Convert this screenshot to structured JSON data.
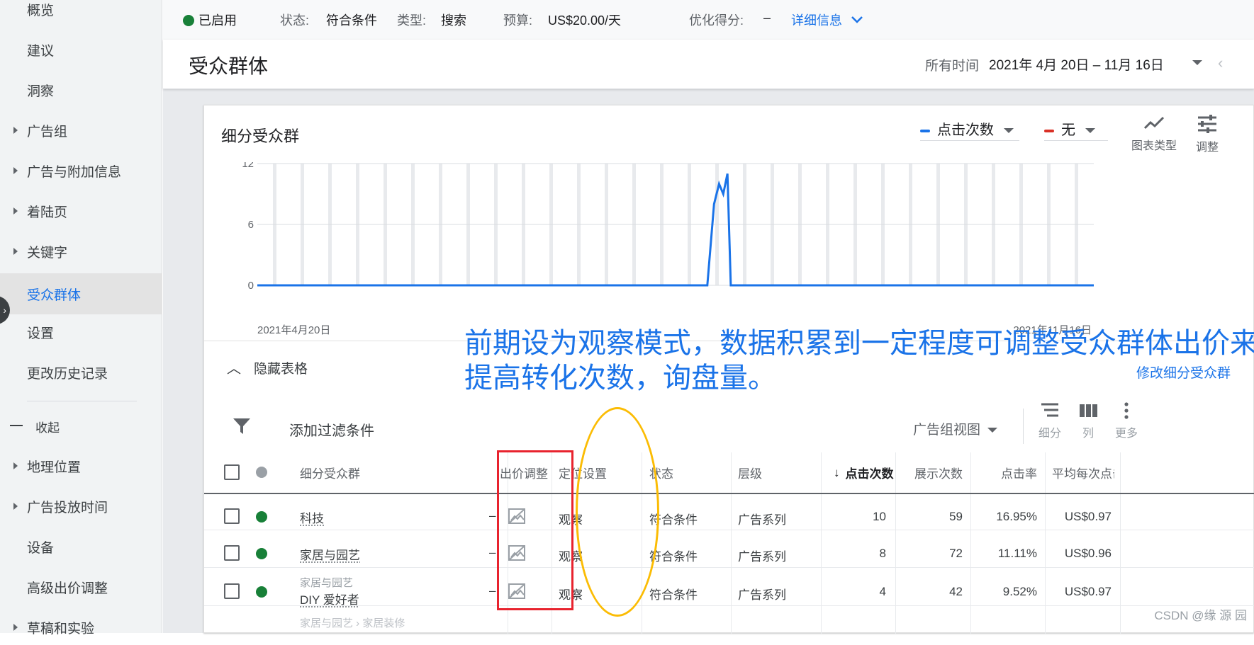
{
  "sidebar": {
    "items": [
      {
        "label": "概览",
        "caret": false
      },
      {
        "label": "建议",
        "caret": false
      },
      {
        "label": "洞察",
        "caret": false
      },
      {
        "label": "广告组",
        "caret": true
      },
      {
        "label": "广告与附加信息",
        "caret": true
      },
      {
        "label": "着陆页",
        "caret": true
      },
      {
        "label": "关键字",
        "caret": true
      },
      {
        "label": "受众群体",
        "caret": false,
        "active": true
      },
      {
        "label": "设置",
        "caret": false
      },
      {
        "label": "更改历史记录",
        "caret": false
      }
    ],
    "collapse_label": "收起",
    "more_items": [
      {
        "label": "地理位置",
        "caret": true
      },
      {
        "label": "广告投放时间",
        "caret": true
      },
      {
        "label": "设备",
        "caret": false
      },
      {
        "label": "高级出价调整",
        "caret": false
      },
      {
        "label": "草稿和实验",
        "caret": true
      }
    ]
  },
  "status_bar": {
    "enabled": "已启用",
    "status_label": "状态:",
    "status_value": "符合条件",
    "type_label": "类型:",
    "type_value": "搜索",
    "budget_label": "预算:",
    "budget_value": "US$20.00/天",
    "score_label": "优化得分:",
    "score_value": "–",
    "details_link": "详细信息"
  },
  "header": {
    "title": "受众群体",
    "date_label": "所有时间",
    "date_range": "2021年 4月 20日 – 11月 16日"
  },
  "chart_section": {
    "title": "细分受众群",
    "metric1": "点击次数",
    "metric1_color": "#1a73e8",
    "metric2": "无",
    "metric2_color": "#d93025",
    "chart_type_label": "图表类型",
    "adjust_label": "调整"
  },
  "chart_data": {
    "type": "line",
    "series": [
      {
        "name": "点击次数",
        "color": "#1a73e8",
        "points": [
          [
            0,
            0
          ],
          [
            0.538,
            0
          ],
          [
            0.546,
            8
          ],
          [
            0.552,
            10
          ],
          [
            0.557,
            9
          ],
          [
            0.562,
            11
          ],
          [
            0.566,
            0
          ],
          [
            1,
            0
          ]
        ]
      }
    ],
    "yticks": [
      0,
      6,
      12
    ],
    "ylim": [
      0,
      12
    ],
    "x_start_label": "2021年4月20日",
    "x_end_label": "2021年11月16日",
    "grid": true
  },
  "annotation": {
    "line1": "前期设为观察模式，数据积累到一定程度可调整受众群体出价来",
    "line2": "提高转化次数，询盘量。"
  },
  "table_controls": {
    "hide_table": "隐藏表格",
    "modify_segments": "修改细分受众群",
    "add_filter": "添加过滤条件",
    "adgroup_view": "广告组视图",
    "segment": "细分",
    "columns": "列",
    "more": "更多"
  },
  "table": {
    "headers": {
      "segment": "细分受众群",
      "bid_adj": "出价调整",
      "targeting": "定位设置",
      "status": "状态",
      "level": "层级",
      "clicks": "点击次数",
      "impressions": "展示次数",
      "ctr": "点击率",
      "avg_cpc": "平均每次点击"
    },
    "rows": [
      {
        "parent": "",
        "segment": "科技",
        "bid_adj": "–",
        "targeting": "观察",
        "status": "符合条件",
        "level": "广告系列",
        "clicks": "10",
        "impressions": "59",
        "ctr": "16.95%",
        "avg_cpc": "US$0.97"
      },
      {
        "parent": "",
        "segment": "家居与园艺",
        "bid_adj": "–",
        "targeting": "观察",
        "status": "符合条件",
        "level": "广告系列",
        "clicks": "8",
        "impressions": "72",
        "ctr": "11.11%",
        "avg_cpc": "US$0.96"
      },
      {
        "parent": "家居与园艺",
        "segment": "DIY 爱好者",
        "bid_adj": "–",
        "targeting": "观察",
        "status": "符合条件",
        "level": "广告系列",
        "clicks": "4",
        "impressions": "42",
        "ctr": "9.52%",
        "avg_cpc": "US$0.97"
      }
    ],
    "partial_row": "家居与园艺 › 家居装修"
  },
  "watermark": "CSDN @缘 源 园"
}
